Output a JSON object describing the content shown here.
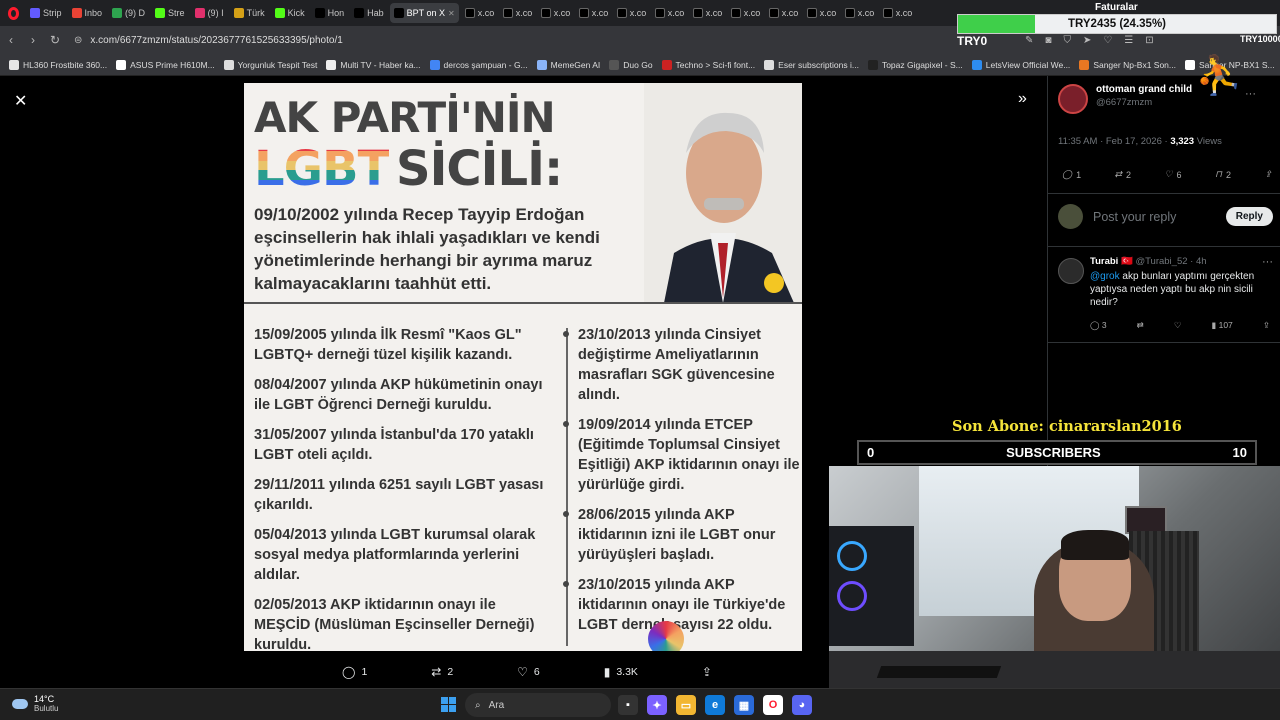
{
  "browser": {
    "tabs": [
      {
        "label": "Strip",
        "color": "#635bff",
        "active": false
      },
      {
        "label": "Inbo",
        "color": "#ea4335",
        "active": false
      },
      {
        "label": "(9) D",
        "color": "#2ea44f",
        "active": false
      },
      {
        "label": "Stre",
        "color": "#53fc18",
        "active": false
      },
      {
        "label": "(9) I",
        "color": "#e1306c",
        "active": false
      },
      {
        "label": "Türk",
        "color": "#d4a017",
        "active": false
      },
      {
        "label": "Kick",
        "color": "#53fc18",
        "active": false
      },
      {
        "label": "Hon",
        "color": "#000000",
        "active": false
      },
      {
        "label": "Hab",
        "color": "#000000",
        "active": false
      },
      {
        "label": "BPT on X",
        "color": "#000000",
        "active": true
      },
      {
        "label": "x.co",
        "color": "#000000",
        "active": false
      },
      {
        "label": "x.co",
        "color": "#000000",
        "active": false
      },
      {
        "label": "x.co",
        "color": "#000000",
        "active": false
      },
      {
        "label": "x.co",
        "color": "#000000",
        "active": false
      },
      {
        "label": "x.co",
        "color": "#000000",
        "active": false
      },
      {
        "label": "x.co",
        "color": "#000000",
        "active": false
      },
      {
        "label": "x.co",
        "color": "#000000",
        "active": false
      },
      {
        "label": "x.co",
        "color": "#000000",
        "active": false
      },
      {
        "label": "x.co",
        "color": "#000000",
        "active": false
      },
      {
        "label": "x.co",
        "color": "#000000",
        "active": false
      },
      {
        "label": "x.co",
        "color": "#000000",
        "active": false
      },
      {
        "label": "x.co",
        "color": "#000000",
        "active": false
      }
    ],
    "url": "x.com/6677zmzm/status/2023677761525633395/photo/1",
    "bookmarks": [
      {
        "label": "HL360 Frostbite 360...",
        "color": "#e6e6e6"
      },
      {
        "label": "ASUS Prime H610M...",
        "color": "#ffffff"
      },
      {
        "label": "Yorgunluk Tespit Test",
        "color": "#dddddd"
      },
      {
        "label": "Multi TV - Haber ka...",
        "color": "#eeeeee"
      },
      {
        "label": "dercos şampuan - G...",
        "color": "#4285f4"
      },
      {
        "label": "MemeGen AI",
        "color": "#8ab4f8"
      },
      {
        "label": "Duo Go",
        "color": "#555555"
      },
      {
        "label": "Techno > Sci-fi font...",
        "color": "#cc2222"
      },
      {
        "label": "Eser subscriptions i...",
        "color": "#dddddd"
      },
      {
        "label": "Topaz Gigapixel - S...",
        "color": "#222222"
      },
      {
        "label": "LetsView Official We...",
        "color": "#2d8cf0"
      },
      {
        "label": "Sanger Np-Bx1 Son...",
        "color": "#e87722"
      },
      {
        "label": "Sanger NP-BX1 S...",
        "color": "#ffffff"
      }
    ]
  },
  "overlay": {
    "progress_text": "TRY2435 (24.35%)",
    "progress_fraction": 0.2435,
    "progress_fill_color": "#3fcf4a",
    "progress_label": "TRY0",
    "progress_end_label": "TRY10000",
    "faturalar": "Faturalar",
    "son_abone": "Son Abone: cinararslan2016",
    "subs_left": "0",
    "subs_title": "SUBSCRIBERS",
    "subs_right": "10"
  },
  "photo": {
    "title_line1": "AK PARTİ'NİN",
    "title_lgbt": "LGBT",
    "title_sicil": "SİCİLİ:",
    "intro": "09/10/2002 yılında Recep Tayyip Erdoğan eşcinsellerin hak ihlali yaşadıkları ve kendi yönetimlerinde herhangi bir ayrıma maruz kalmayacaklarını taahhüt etti.",
    "left_items": [
      "15/09/2005 yılında İlk Resmî \"Kaos GL\" LGBTQ+ derneği tüzel kişilik kazandı.",
      "08/04/2007 yılında AKP hükümetinin onayı ile LGBT Öğrenci Derneği kuruldu.",
      "31/05/2007 yılında İstanbul'da 170 yataklı LGBT oteli açıldı.",
      "29/11/2011 yılında 6251 sayılı LGBT yasası çıkarıldı.",
      "05/04/2013 yılında LGBT kurumsal olarak sosyal medya platformlarında yerlerini aldılar.",
      "02/05/2013 AKP iktidarının onayı ile MEŞCİD (Müslüman Eşcinseller Derneği) kuruldu."
    ],
    "right_items": [
      "23/10/2013 yılında Cinsiyet değiştirme Ameliyatlarının masrafları SGK güvencesine alındı.",
      "19/09/2014 yılında ETCEP (Eğitimde Toplumsal Cinsiyet Eşitliği) AKP iktidarının onayı ile yürürlüğe girdi.",
      "28/06/2015 yılında AKP iktidarının izni ile LGBT onur yürüyüşleri başladı.",
      "23/10/2015 yılında AKP iktidarının onayı ile Türkiye'de LGBT dernek sayısı 22 oldu."
    ]
  },
  "photo_actions": {
    "replies": "1",
    "reposts": "2",
    "likes": "6",
    "views": "3.3K"
  },
  "post": {
    "author_name": "ottoman grand child",
    "author_handle": "@6677zmzm",
    "time": "11:35 AM · Feb 17, 2026 · ",
    "views_count": "3,323",
    "views_label": " Views",
    "replies": "1",
    "reposts": "2",
    "likes": "6",
    "bookmarks": "2",
    "reply_placeholder": "Post your reply",
    "reply_button": "Reply"
  },
  "reply": {
    "name": "Turabi",
    "flag": "🇹🇷",
    "handle": "@Turabi_52 · 4h",
    "mention": "@grok",
    "text": " akp bunları yaptımı gerçekten yaptıysa neden yaptı bu akp nin sicili nedir?",
    "replies": "3",
    "views": "107"
  },
  "taskbar": {
    "temp": "14°C",
    "weather": "Bulutlu",
    "search": "Ara"
  }
}
